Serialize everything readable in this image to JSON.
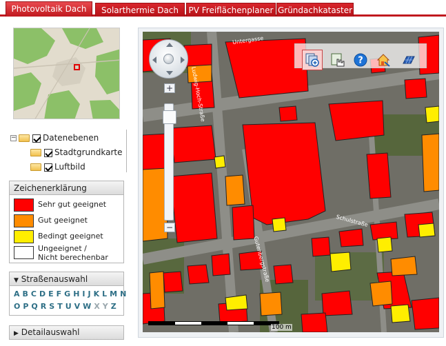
{
  "tabs": [
    {
      "label": "Photovoltaik Dach",
      "active": true
    },
    {
      "label": "Solarthermie Dach",
      "active": false
    },
    {
      "label": "PV Freiflächenplaner",
      "active": false
    },
    {
      "label": "Gründachkataster",
      "active": false
    }
  ],
  "layers": {
    "root": {
      "label": "Datenebenen",
      "checked": true
    },
    "items": [
      {
        "label": "Stadtgrundkarte",
        "checked": true
      },
      {
        "label": "Luftbild",
        "checked": true
      }
    ]
  },
  "legend": {
    "title": "Zeichenerklärung",
    "items": [
      {
        "label": "Sehr gut geeignet",
        "color": "#ff0000"
      },
      {
        "label": "Gut geeignet",
        "color": "#ff8c00"
      },
      {
        "label": "Bedingt geeignet",
        "color": "#ffee00"
      },
      {
        "label_line1": "Ungeeignet /",
        "label_line2": "Nicht berechenbar",
        "color": "#ffffff"
      }
    ]
  },
  "street_panel": {
    "title": "Straßenauswahl",
    "toggle_icon": "triangle-down-icon",
    "row1": [
      "A",
      "B",
      "C",
      "D",
      "E",
      "F",
      "G",
      "H",
      "I",
      "J",
      "K",
      "L",
      "M",
      "N"
    ],
    "row2": [
      "O",
      "P",
      "Q",
      "R",
      "S",
      "T",
      "U",
      "V",
      "W",
      "X",
      "Y",
      "Z"
    ],
    "dimmed": [
      "X",
      "Y"
    ]
  },
  "detail_panel": {
    "title": "Detailauswahl",
    "toggle_icon": "triangle-right-icon"
  },
  "map": {
    "zoom_in_label": "+",
    "zoom_out_label": "−",
    "scale_label": "100 m",
    "streets": [
      "Untergasse",
      "Ludwig-Hoch-Straße",
      "Schulstraße",
      "Gutenbergstraße"
    ],
    "toolbar_icons": [
      "layer-info-icon",
      "select-hand-icon",
      "help-icon",
      "house-search-icon",
      "solar-panel-icon"
    ]
  },
  "colors": {
    "accent": "#c0181e",
    "link": "#2e6f86"
  }
}
